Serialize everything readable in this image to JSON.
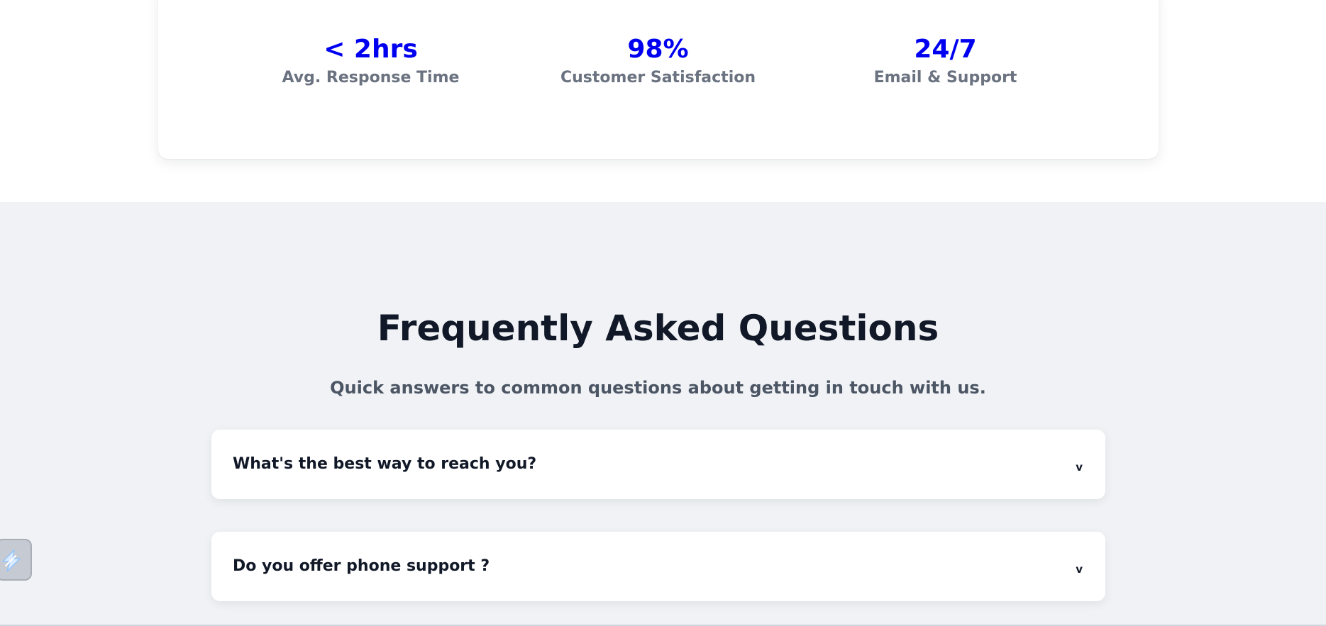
{
  "stats": [
    {
      "value": "< 2hrs",
      "label": "Avg. Response Time"
    },
    {
      "value": "98%",
      "label": "Customer Satisfaction"
    },
    {
      "value": "24/7",
      "label": "Email & Support"
    }
  ],
  "faq": {
    "title": "Frequently Asked Questions",
    "subtitle": "Quick answers to common questions about getting in touch with us.",
    "items": [
      {
        "question": "What's the best way to reach you?",
        "chevron": "v"
      },
      {
        "question": "Do you offer phone support ?",
        "chevron": "v"
      }
    ]
  },
  "widget": {
    "icon": "lightning-icon"
  },
  "colors": {
    "accent": "#0000f0",
    "heading": "#111827",
    "muted": "#6b7280",
    "section_bg": "#f0f2f5"
  }
}
